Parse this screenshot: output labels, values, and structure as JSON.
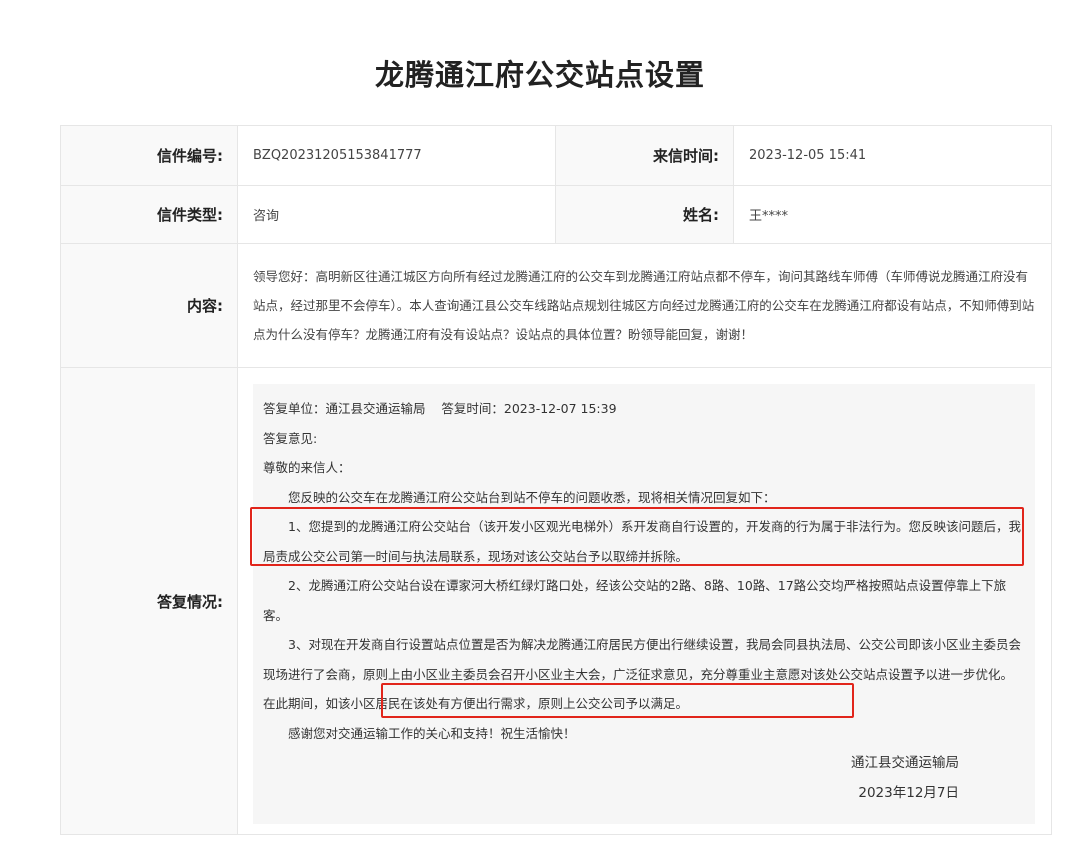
{
  "page": {
    "title": "龙腾通江府公交站点设置"
  },
  "letter": {
    "number_label": "信件编号:",
    "number": "BZQ20231205153841777",
    "time_label": "来信时间:",
    "time": "2023-12-05 15:41",
    "type_label": "信件类型:",
    "type": "咨询",
    "name_label": "姓名:",
    "name": "王****",
    "content_label": "内容:",
    "content": "领导您好：高明新区往通江城区方向所有经过龙腾通江府的公交车到龙腾通江府站点都不停车，询问其路线车师傅（车师傅说龙腾通江府没有站点，经过那里不会停车）。本人查询通江县公交车线路站点规划往城区方向经过龙腾通江府的公交车在龙腾通江府都设有站点，不知师傅到站点为什么没有停车？龙腾通江府有没有设站点？设站点的具体位置？盼领导能回复，谢谢！"
  },
  "reply": {
    "label": "答复情况:",
    "header": "答复单位：通江县交通运输局    答复时间：2023-12-07 15:39",
    "opinion_label": "答复意见:",
    "greeting": "尊敬的来信人：",
    "intro": "您反映的公交车在龙腾通江府公交站台到站不停车的问题收悉，现将相关情况回复如下：",
    "item1": "1、您提到的龙腾通江府公交站台（该开发小区观光电梯外）系开发商自行设置的，开发商的行为属于非法行为。您反映该问题后，我局责成公交公司第一时间与执法局联系，现场对该公交站台予以取缔并拆除。",
    "item2": "2、龙腾通江府公交站台设在谭家河大桥红绿灯路口处，经该公交站的2路、8路、10路、17路公交均严格按照站点设置停靠上下旅客。",
    "item3": "3、对现在开发商自行设置站点位置是否为解决龙腾通江府居民方便出行继续设置，我局会同县执法局、公交公司即该小区业主委员会现场进行了会商，原则上由小区业主委员会召开小区业主大会，广泛征求意见，充分尊重业主意愿对该处公交站点设置予以进一步优化。在此期间，如该小区居民在该处有方便出行需求，原则上公交公司予以满足。",
    "thanks": "感谢您对交通运输工作的关心和支持！祝生活愉快！",
    "sign_unit": "通江县交通运输局",
    "sign_date": "2023年12月7日"
  },
  "annotation_color": "#e1251b"
}
